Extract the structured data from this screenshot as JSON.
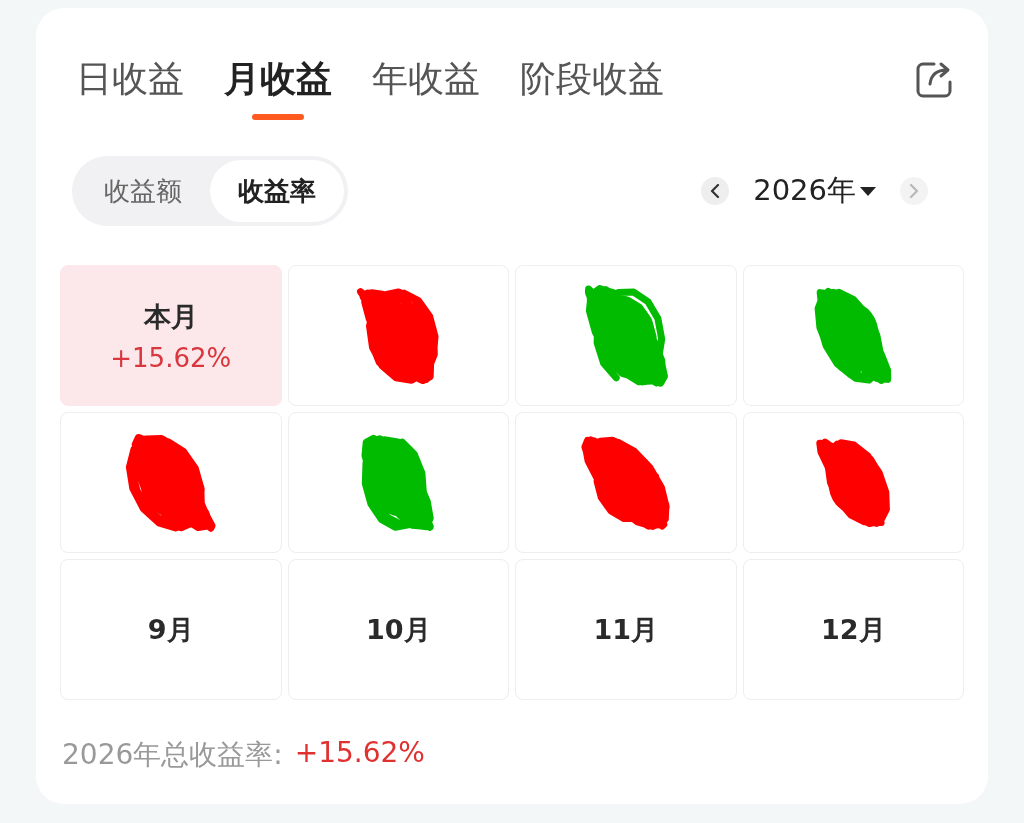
{
  "tabs": [
    {
      "label": "日收益",
      "selected": false
    },
    {
      "label": "月收益",
      "selected": true
    },
    {
      "label": "年收益",
      "selected": false
    },
    {
      "label": "阶段收益",
      "selected": false
    }
  ],
  "segments": [
    {
      "label": "收益额",
      "selected": false
    },
    {
      "label": "收益率",
      "selected": true
    }
  ],
  "year_picker": {
    "prev": {
      "disabled": false
    },
    "label": "2026年",
    "next": {
      "disabled": true
    }
  },
  "months": [
    {
      "kind": "month",
      "label": "本月",
      "value": "+15.62%",
      "selected": true
    },
    {
      "kind": "scribbled",
      "color": "#ff0000",
      "selected": false
    },
    {
      "kind": "scribbled",
      "color": "#00bb00",
      "selected": false
    },
    {
      "kind": "scribbled",
      "color": "#00bb00",
      "selected": false
    },
    {
      "kind": "scribbled",
      "color": "#ff0000",
      "selected": false
    },
    {
      "kind": "scribbled",
      "color": "#00bb00",
      "selected": false
    },
    {
      "kind": "scribbled",
      "color": "#ff0000",
      "selected": false
    },
    {
      "kind": "scribbled",
      "color": "#ff0000",
      "selected": false
    },
    {
      "kind": "month",
      "label": "9月",
      "selected": false
    },
    {
      "kind": "month",
      "label": "10月",
      "selected": false
    },
    {
      "kind": "month",
      "label": "11月",
      "selected": false
    },
    {
      "kind": "month",
      "label": "12月",
      "selected": false
    }
  ],
  "total": {
    "label": "2026年总收益率:",
    "value": "+15.62%"
  }
}
